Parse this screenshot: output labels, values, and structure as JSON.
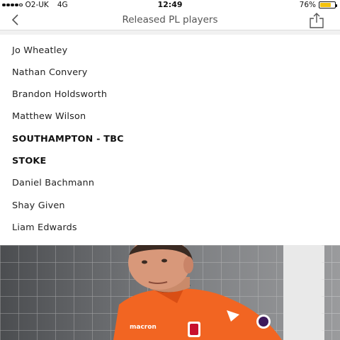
{
  "status_bar": {
    "carrier": "O2-UK",
    "network": "4G",
    "time": "12:49",
    "battery_percent": "76%",
    "battery_level": 0.76,
    "battery_color": "#f4c20d"
  },
  "nav": {
    "back_icon": "chevron-left-icon",
    "title": "Released PL players",
    "share_icon": "share-icon"
  },
  "list": {
    "items": [
      {
        "text": "Jo Wheatley",
        "heading": false
      },
      {
        "text": "Nathan Convery",
        "heading": false
      },
      {
        "text": "Brandon Holdsworth",
        "heading": false
      },
      {
        "text": "Matthew Wilson",
        "heading": false
      },
      {
        "text": "SOUTHAMPTON - TBC",
        "heading": true
      },
      {
        "text": "STOKE",
        "heading": true
      },
      {
        "text": "Daniel Bachmann",
        "heading": false
      },
      {
        "text": "Shay Given",
        "heading": false
      },
      {
        "text": "Liam Edwards",
        "heading": false
      }
    ]
  },
  "photo": {
    "kit_color": "#f26522",
    "shirt_sponsor": "macron"
  }
}
